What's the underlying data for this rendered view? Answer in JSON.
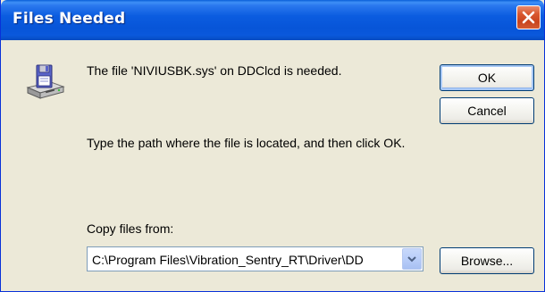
{
  "window": {
    "title": "Files Needed"
  },
  "message": {
    "file_needed": "The file 'NIVIUSBK.sys' on DDClcd is needed.",
    "hint": "Type the path where the file is located, and then click OK."
  },
  "copy_from": {
    "label": "Copy files from:",
    "value": "C:\\Program Files\\Vibration_Sentry_RT\\Driver\\DD"
  },
  "buttons": {
    "ok": "OK",
    "cancel": "Cancel",
    "browse": "Browse..."
  },
  "icons": {
    "close": "close-icon",
    "disk": "floppy-disk-drive-icon",
    "dropdown": "chevron-down-icon"
  },
  "colors": {
    "titlebar": "#0b5ce0",
    "dialog_bg": "#ece9d8",
    "close_button": "#d9572e",
    "button_border": "#003c74"
  }
}
